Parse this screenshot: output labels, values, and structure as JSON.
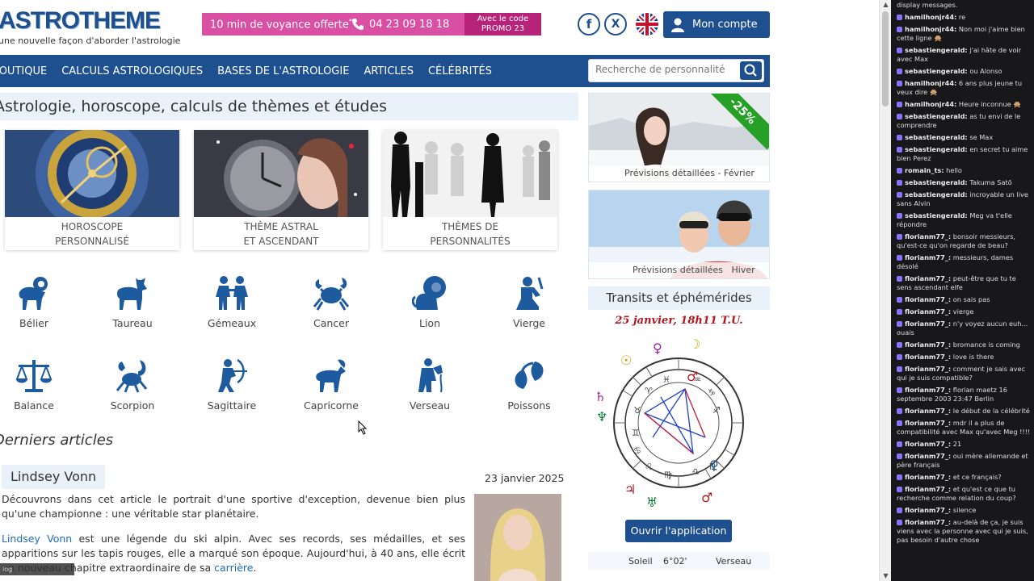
{
  "header": {
    "logo_text": "ASTROTHEME",
    "tagline": "une nouvelle façon d'aborder l'astrologie",
    "promo_text": "10 min de voyance offerte",
    "promo_star": "*",
    "promo_phone": "04 23 09 18 18",
    "promo_code_line1": "Avec le code",
    "promo_code_line2": "PROMO 23",
    "account_label": "Mon compte"
  },
  "nav": {
    "items": [
      "BOUTIQUE",
      "CALCULS ASTROLOGIQUES",
      "BASES DE L'ASTROLOGIE",
      "ARTICLES",
      "CÉLÉBRITÉS"
    ],
    "search_placeholder": "Recherche de personnalité"
  },
  "main": {
    "heading": "Astrologie, horoscope, calculs de thèmes et études",
    "cards": [
      {
        "line1": "HOROSCOPE",
        "line2": "PERSONNALISÉ"
      },
      {
        "line1": "THÈME ASTRAL",
        "line2": "ET ASCENDANT"
      },
      {
        "line1": "THÈMES DE",
        "line2": "PERSONNALITÉS"
      }
    ],
    "signs": [
      "Bélier",
      "Taureau",
      "Gémeaux",
      "Cancer",
      "Lion",
      "Vierge",
      "Balance",
      "Scorpion",
      "Sagittaire",
      "Capricorne",
      "Verseau",
      "Poissons"
    ],
    "articles_heading": "Derniers articles",
    "article": {
      "title": "Lindsey Vonn",
      "date": "23 janvier 2025",
      "p1": "Découvrons dans cet article le portrait d'une sportive d'exception, devenue bien plus qu'une championne : une véritable star planétaire.",
      "p2_link": "Lindsey Vonn",
      "p2_rest": " est une légende du ski alpin. Avec ses records, ses médailles, et ses apparitions sur les tapis rouges, elle a marqué son époque. Aujourd'hui, à 40 ans, elle écrit un nouveau chapitre extraordinaire de sa ",
      "p2_link2": "carrière",
      "p2_end": "."
    }
  },
  "sidebar": {
    "ad1_badge": "-25%",
    "ad1_caption_left": "Prévisions détaillées",
    "ad1_caption_right": "Février",
    "ad2_caption_left": "Prévisions détaillées",
    "ad2_caption_right": "Hiver",
    "transit_title": "Transits et éphémérides",
    "transit_date": "25 janvier, 18h11 T.U.",
    "app_button": "Ouvrir l'application",
    "sun_row": {
      "planet": "Soleil",
      "degree": "6°02'",
      "sign": "Verseau"
    }
  },
  "overlay": {
    "bottom_badge": "log"
  },
  "chat": {
    "messages": [
      {
        "user": "",
        "text": "display messages."
      },
      {
        "user": "hamilhonjr44:",
        "text": "re"
      },
      {
        "user": "hamilhonjr44:",
        "text": "Non moi j'aime bien cette ligne 🙊"
      },
      {
        "user": "sebastiengerald:",
        "text": "j'ai hâte de voir avec Max"
      },
      {
        "user": "sebastiengerald:",
        "text": "ou Alonso"
      },
      {
        "user": "hamilhonjr44:",
        "text": "6 ans plus jeune tu veux dire 🙊"
      },
      {
        "user": "hamilhonjr44:",
        "text": "Heure inconnue 🙊"
      },
      {
        "user": "sebastiengerald:",
        "text": "as tu envi de le comprendre"
      },
      {
        "user": "sebastiengerald:",
        "text": "se Max"
      },
      {
        "user": "sebastiengerald:",
        "text": "en secret tu aime bien Perez"
      },
      {
        "user": "romain_ts:",
        "text": "hello"
      },
      {
        "user": "sebastiengerald:",
        "text": "Takuma Satō"
      },
      {
        "user": "sebastiengerald:",
        "text": "incroyable un live sans Alvin"
      },
      {
        "user": "sebastiengerald:",
        "text": "Meg va t'elle répondre"
      },
      {
        "user": "florianm77_:",
        "text": "bonsoir messieurs, qu'est-ce qu'on regarde de beau?"
      },
      {
        "user": "florianm77_:",
        "text": "messieurs, dames désolé"
      },
      {
        "user": "florianm77_:",
        "text": "peut-être que tu te sens ascendant elfe"
      },
      {
        "user": "florianm77_:",
        "text": "on sais pas"
      },
      {
        "user": "florianm77_:",
        "text": "vierge"
      },
      {
        "user": "florianm77_:",
        "text": "n'y voyez aucun euh... ouais"
      },
      {
        "user": "florianm77_:",
        "text": "bromance is coming"
      },
      {
        "user": "florianm77_:",
        "text": "love is there"
      },
      {
        "user": "florianm77_:",
        "text": "comment je sais avec qui je suis compatible?"
      },
      {
        "user": "florianm77_:",
        "text": "florian maetz 16 septembre 2003 23:47 Berlin"
      },
      {
        "user": "florianm77_:",
        "text": "le début de la célébrité"
      },
      {
        "user": "florianm77_:",
        "text": "mdr il a plus de compatibilité avec Max qu'avec Meg !!!!"
      },
      {
        "user": "florianm77_:",
        "text": "21"
      },
      {
        "user": "florianm77_:",
        "text": "oui mère allemande et père français"
      },
      {
        "user": "florianm77_:",
        "text": "et ce français?"
      },
      {
        "user": "florianm77_:",
        "text": "et qu'est ce que tu recherche comme relation du coup?"
      },
      {
        "user": "florianm77_:",
        "text": "silence"
      },
      {
        "user": "florianm77_:",
        "text": "au-delà de ça, je suis viens avec la personne avec qui je suis, pas besoin d'autre chose"
      }
    ]
  },
  "colors": {
    "brand": "#1e4f8f",
    "promo": "#d94fa3",
    "promo_dark": "#b8237a",
    "accent_red": "#b0171f",
    "chat_bg": "#18181b"
  }
}
